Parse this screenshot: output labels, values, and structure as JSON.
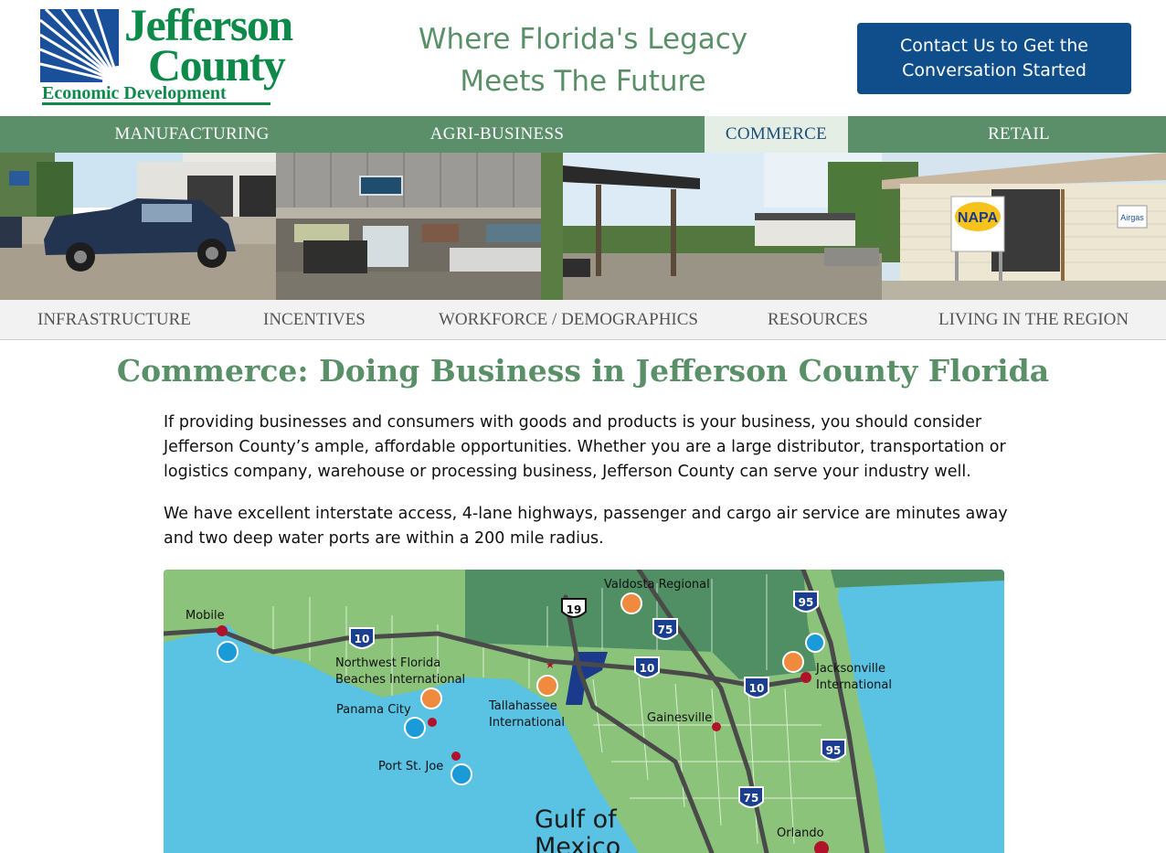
{
  "header": {
    "logo": {
      "line1": "Jefferson",
      "line2": "County",
      "line3": "Economic Development"
    },
    "tagline": [
      "Where Florida's Legacy",
      "Meets The Future"
    ],
    "cta_label": [
      "Contact Us to Get the",
      "Conversation Started"
    ]
  },
  "sector_nav": {
    "items": [
      {
        "label": "MANUFACTURING",
        "active": false
      },
      {
        "label": "AGRI-BUSINESS",
        "active": false
      },
      {
        "label": "COMMERCE",
        "active": true
      },
      {
        "label": "RETAIL",
        "active": false
      }
    ]
  },
  "photos": [
    {
      "name": "auto-shop-pickup-truck"
    },
    {
      "name": "storefront-with-boats-and-atv"
    },
    {
      "name": "gas-station-canopy"
    },
    {
      "name": "napa-airgas-store-front",
      "signs": [
        "NAPA",
        "Airgas"
      ]
    }
  ],
  "sub_nav": {
    "items": [
      "INFRASTRUCTURE",
      "INCENTIVES",
      "WORKFORCE / DEMOGRAPHICS",
      "RESOURCES",
      "LIVING IN THE REGION"
    ]
  },
  "main": {
    "title": "Commerce: Doing Business in Jefferson County Florida",
    "paragraphs": [
      "If providing businesses and consumers with goods and products is your business, you should consider Jefferson County’s ample, affordable opportunities. Whether you are a large distributor, transportation or logistics company, warehouse or processing business, Jefferson County can serve your industry well.",
      "We have excellent interstate access, 4-lane highways, passenger and cargo air service are minutes away and two deep water ports are within a 200 mile radius."
    ]
  },
  "map": {
    "labels": {
      "mobile": "Mobile",
      "valdosta": "Valdosta Regional",
      "nw_florida": [
        "Northwest Florida",
        "Beaches International"
      ],
      "panama_city": "Panama City",
      "port_st_joe": "Port St. Joe",
      "tallahassee": [
        "Tallahassee",
        "International"
      ],
      "gainesville": "Gainesville",
      "jacksonville": [
        "Jacksonville",
        "International"
      ],
      "orlando": "Orlando",
      "gulf": [
        "Gulf of",
        "Mexico"
      ]
    },
    "shields": {
      "i10": "10",
      "i75": "75",
      "i95": "95",
      "us19": "19"
    }
  },
  "colors": {
    "brand_green": "#5a8f69",
    "logo_green": "#0d8a4a",
    "logo_blue": "#1a4f9a",
    "cta_blue": "#0f4e8a",
    "active_tab_bg": "#e4eee4",
    "water": "#5ac3e3",
    "land_florida": "#8cc37a",
    "land_georgia": "#4f8f63",
    "jefferson_county": "#1c3a8c"
  }
}
